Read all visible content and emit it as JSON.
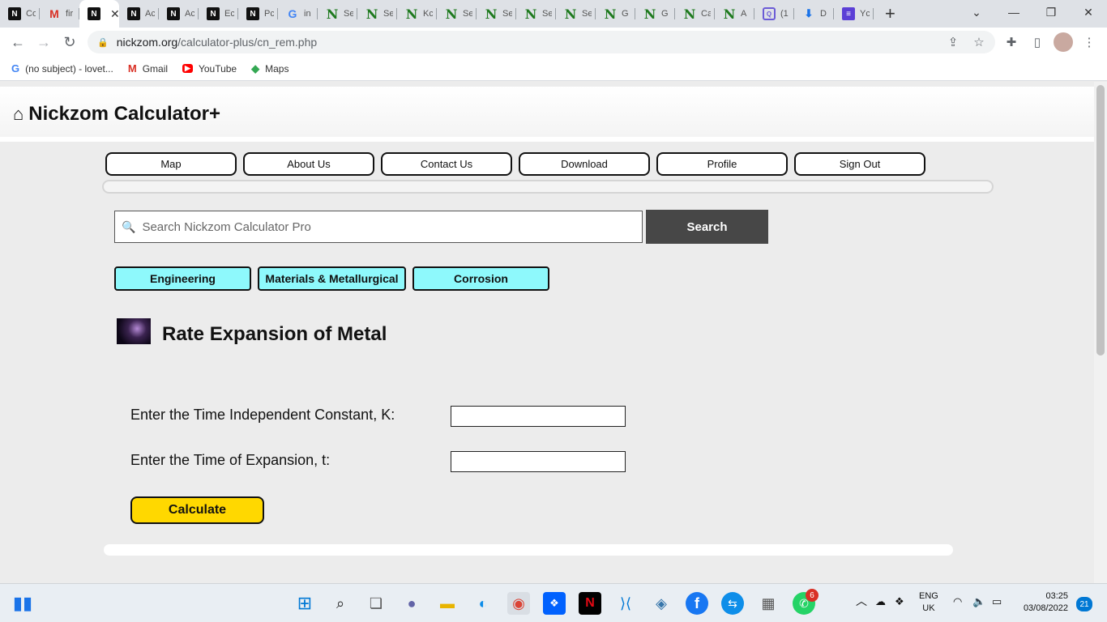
{
  "browser": {
    "tabs": [
      {
        "label": "Co",
        "icon": "nickzom-icon"
      },
      {
        "label": "fir",
        "icon": "gmail-icon"
      },
      {
        "label": "",
        "icon": "nickzom-icon",
        "active": true
      },
      {
        "label": "Ac",
        "icon": "nickzom-icon"
      },
      {
        "label": "Ac",
        "icon": "nickzom-icon"
      },
      {
        "label": "Ec",
        "icon": "nickzom-icon"
      },
      {
        "label": "Pc",
        "icon": "nickzom-icon"
      },
      {
        "label": "in",
        "icon": "google-icon"
      },
      {
        "label": "Se",
        "icon": "green-n-icon"
      },
      {
        "label": "Se",
        "icon": "green-n-icon"
      },
      {
        "label": "Kc",
        "icon": "green-n-icon"
      },
      {
        "label": "Se",
        "icon": "green-n-icon"
      },
      {
        "label": "Se",
        "icon": "green-n-icon"
      },
      {
        "label": "Se",
        "icon": "green-n-icon"
      },
      {
        "label": "Se",
        "icon": "green-n-icon"
      },
      {
        "label": "G",
        "icon": "green-n-icon"
      },
      {
        "label": "G",
        "icon": "green-n-icon"
      },
      {
        "label": "Ca",
        "icon": "green-n-icon"
      },
      {
        "label": "A",
        "icon": "green-n-icon"
      },
      {
        "label": "(1",
        "icon": "search-box-icon"
      },
      {
        "label": "D",
        "icon": "download-icon"
      },
      {
        "label": "Yc",
        "icon": "list-icon"
      }
    ],
    "url_host": "nickzom.org",
    "url_path": "/calculator-plus/cn_rem.php",
    "bookmarks": [
      {
        "label": "(no subject) - lovet...",
        "icon": "google-icon"
      },
      {
        "label": "Gmail",
        "icon": "gmail-icon"
      },
      {
        "label": "YouTube",
        "icon": "youtube-icon"
      },
      {
        "label": "Maps",
        "icon": "maps-icon"
      }
    ]
  },
  "site": {
    "title": "Nickzom Calculator+",
    "nav": [
      "Map",
      "About Us",
      "Contact Us",
      "Download",
      "Profile",
      "Sign Out"
    ],
    "search_placeholder": "Search Nickzom Calculator Pro",
    "search_button": "Search",
    "categories": [
      "Engineering",
      "Materials & Metallurgical",
      "Corrosion"
    ],
    "page_heading": "Rate Expansion of Metal",
    "field1_label": "Enter the Time Independent Constant, K:",
    "field1_value": "",
    "field2_label": "Enter the Time of Expansion, t:",
    "field2_value": "",
    "calculate_button": "Calculate"
  },
  "taskbar": {
    "whatsapp_badge": "6",
    "language": "ENG",
    "region": "UK",
    "time": "03:25",
    "date": "03/08/2022",
    "notification_count": "21"
  },
  "colors": {
    "category_bg": "#8ef9fc",
    "calculate_bg": "#ffd800",
    "search_button_bg": "#474747"
  }
}
